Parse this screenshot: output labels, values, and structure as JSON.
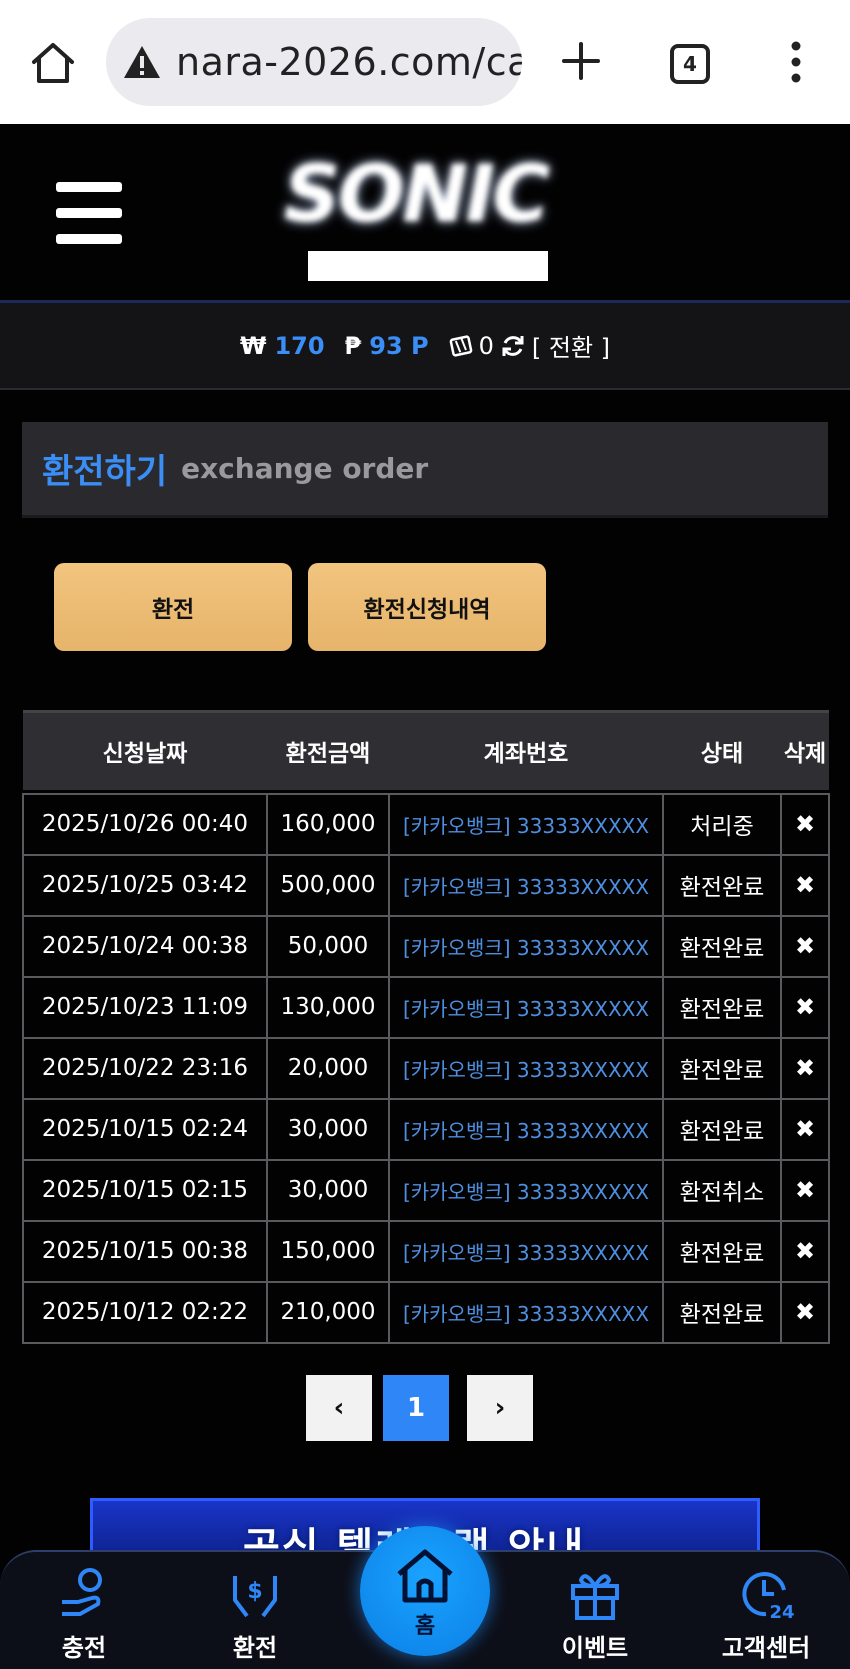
{
  "browser": {
    "url": "nara-2026.com/ca",
    "tab_count": "4"
  },
  "header": {
    "logo_text": "SONIC"
  },
  "balance": {
    "won_symbol": "₩",
    "won_value": "170",
    "point_symbol": "₱",
    "point_value": "93 P",
    "chip_value": "0",
    "convert_label": "[ 전환 ]"
  },
  "section": {
    "title_ko": "환전하기",
    "title_en": "exchange order"
  },
  "buttons": {
    "exchange": "환전",
    "history": "환전신청내역"
  },
  "table": {
    "headers": [
      "신청날짜",
      "환전금액",
      "계좌번호",
      "상태",
      "삭제"
    ],
    "rows": [
      {
        "date": "2025/10/26 00:40",
        "amount": "160,000",
        "account": "[카카오뱅크] 33333XXXXX",
        "status": "처리중",
        "delete": "✖"
      },
      {
        "date": "2025/10/25 03:42",
        "amount": "500,000",
        "account": "[카카오뱅크] 33333XXXXX",
        "status": "환전완료",
        "delete": "✖"
      },
      {
        "date": "2025/10/24 00:38",
        "amount": "50,000",
        "account": "[카카오뱅크] 33333XXXXX",
        "status": "환전완료",
        "delete": "✖"
      },
      {
        "date": "2025/10/23 11:09",
        "amount": "130,000",
        "account": "[카카오뱅크] 33333XXXXX",
        "status": "환전완료",
        "delete": "✖"
      },
      {
        "date": "2025/10/22 23:16",
        "amount": "20,000",
        "account": "[카카오뱅크] 33333XXXXX",
        "status": "환전완료",
        "delete": "✖"
      },
      {
        "date": "2025/10/15 02:24",
        "amount": "30,000",
        "account": "[카카오뱅크] 33333XXXXX",
        "status": "환전완료",
        "delete": "✖"
      },
      {
        "date": "2025/10/15 02:15",
        "amount": "30,000",
        "account": "[카카오뱅크] 33333XXXXX",
        "status": "환전취소",
        "delete": "✖"
      },
      {
        "date": "2025/10/15 00:38",
        "amount": "150,000",
        "account": "[카카오뱅크] 33333XXXXX",
        "status": "환전완료",
        "delete": "✖"
      },
      {
        "date": "2025/10/12 02:22",
        "amount": "210,000",
        "account": "[카카오뱅크] 33333XXXXX",
        "status": "환전완료",
        "delete": "✖"
      }
    ]
  },
  "pagination": {
    "prev": "‹",
    "current": "1",
    "next": "›"
  },
  "banner": {
    "text": "공식 텔레그램 안내"
  },
  "bottom_nav": {
    "charge": "충전",
    "exchange": "환전",
    "home": "홈",
    "event": "이벤트",
    "support": "고객센터"
  },
  "colors": {
    "accent_blue": "#3a8ef6",
    "button_gold": "#f2c47e",
    "background": "#020203"
  }
}
